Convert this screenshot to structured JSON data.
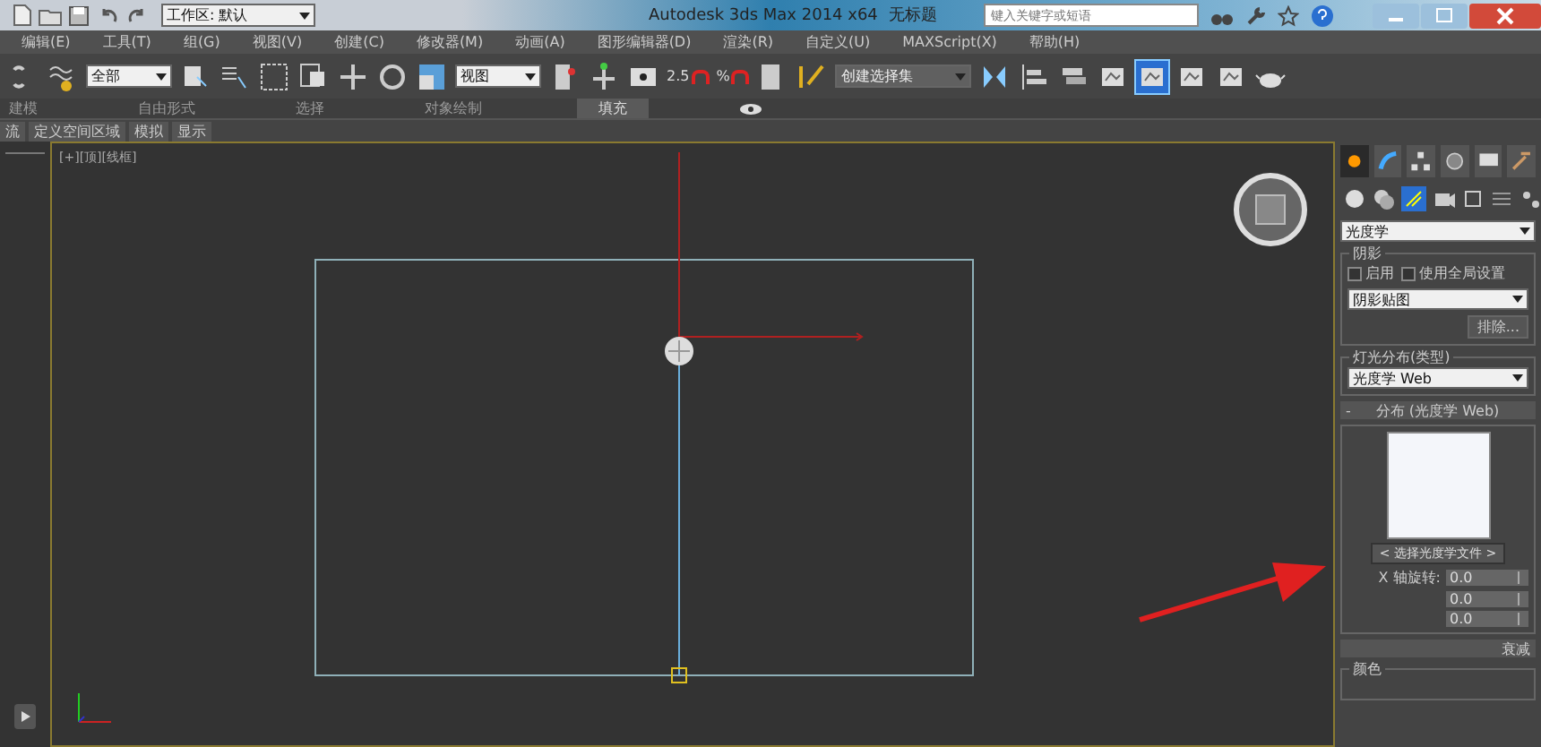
{
  "title_bar": {
    "workspace": "工作区: 默认",
    "app_title": "Autodesk 3ds Max  2014 x64",
    "document": "无标题",
    "search": {
      "placeholder": "键入关键字或短语"
    }
  },
  "menu": [
    "编辑(E)",
    "工具(T)",
    "组(G)",
    "视图(V)",
    "创建(C)",
    "修改器(M)",
    "动画(A)",
    "图形编辑器(D)",
    "渲染(R)",
    "自定义(U)",
    "MAXScript(X)",
    "帮助(H)"
  ],
  "toolbar": {
    "selection_filter": "全部",
    "reference_coord": "视图",
    "snap_labels": [
      "2.5",
      "%"
    ],
    "selection_set": "创建选择集",
    "render_tools": [
      {
        "kind": "render",
        "selected": false
      },
      {
        "kind": "render",
        "selected": true
      },
      {
        "kind": "render",
        "selected": false
      },
      {
        "kind": "render",
        "selected": false
      }
    ]
  },
  "ribbon_tabs": [
    {
      "label": "建模",
      "selected": false
    },
    {
      "label": "自由形式",
      "selected": false
    },
    {
      "label": "选择",
      "selected": false
    },
    {
      "label": "对象绘制",
      "selected": false
    },
    {
      "label": "填充",
      "selected": true
    }
  ],
  "ribbon_panel": [
    "流",
    "定义空间区域",
    "模拟",
    "显示"
  ],
  "viewport": {
    "label": "[+][顶][线框]"
  },
  "command_panel": {
    "tabs": [
      {
        "kind": "create",
        "selected": true
      },
      {
        "kind": "modify",
        "selected": false
      },
      {
        "kind": "hierarchy",
        "selected": false
      },
      {
        "kind": "motion",
        "selected": false
      },
      {
        "kind": "display",
        "selected": false
      },
      {
        "kind": "utilities",
        "selected": false
      }
    ],
    "category": "光度学",
    "shadows": {
      "title": "阴影",
      "options": [
        {
          "label": "启用",
          "checked": false
        },
        {
          "label": "使用全局设置",
          "checked": false
        }
      ],
      "type": "阴影贴图",
      "exclude": "排除..."
    },
    "distribution": {
      "title": "灯光分布(类型)",
      "value": "光度学 Web"
    },
    "web_rollout": {
      "collapse_sign": "-",
      "title": "分布 (光度学 Web)",
      "file_button": "< 选择光度学文件 >",
      "rotations": [
        {
          "label": "X 轴旋转:",
          "value": "0.0"
        },
        {
          "value": "0.0"
        },
        {
          "value": "0.0"
        }
      ]
    },
    "next_rollout": "衰减",
    "color_group": "颜色"
  }
}
